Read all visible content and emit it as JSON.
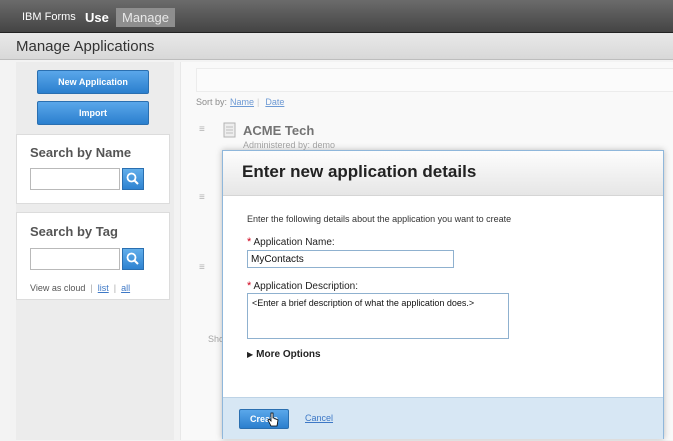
{
  "topbar": {
    "brand": "IBM Forms",
    "nav": [
      "Use",
      "Manage"
    ]
  },
  "page_title": "Manage Applications",
  "sidebar": {
    "new_application": "New Application",
    "import": "Import",
    "search_name_heading": "Search by Name",
    "search_tag_heading": "Search by Tag",
    "view_as_cloud": "View as cloud",
    "list_link": "list",
    "all_link": "all"
  },
  "main": {
    "sort_by": "Sort by:",
    "sort_name": "Name",
    "sort_date": "Date",
    "app_name": "ACME Tech",
    "app_admin": "Administered by: demo",
    "show_fragment": "Sho"
  },
  "modal": {
    "title": "Enter new application details",
    "description": "Enter the following details about the application you want to create",
    "required_marker": "*",
    "name_label": "Application Name:",
    "name_value": "MyContacts",
    "desc_label": "Application Description:",
    "desc_value": "<Enter a brief description of what the application does.>",
    "more_options": "More Options",
    "create_label": "Create",
    "cancel_label": "Cancel"
  },
  "colors": {
    "accent_blue": "#2b7fce",
    "link_blue": "#3d78c6",
    "required_red": "#d0021b"
  }
}
